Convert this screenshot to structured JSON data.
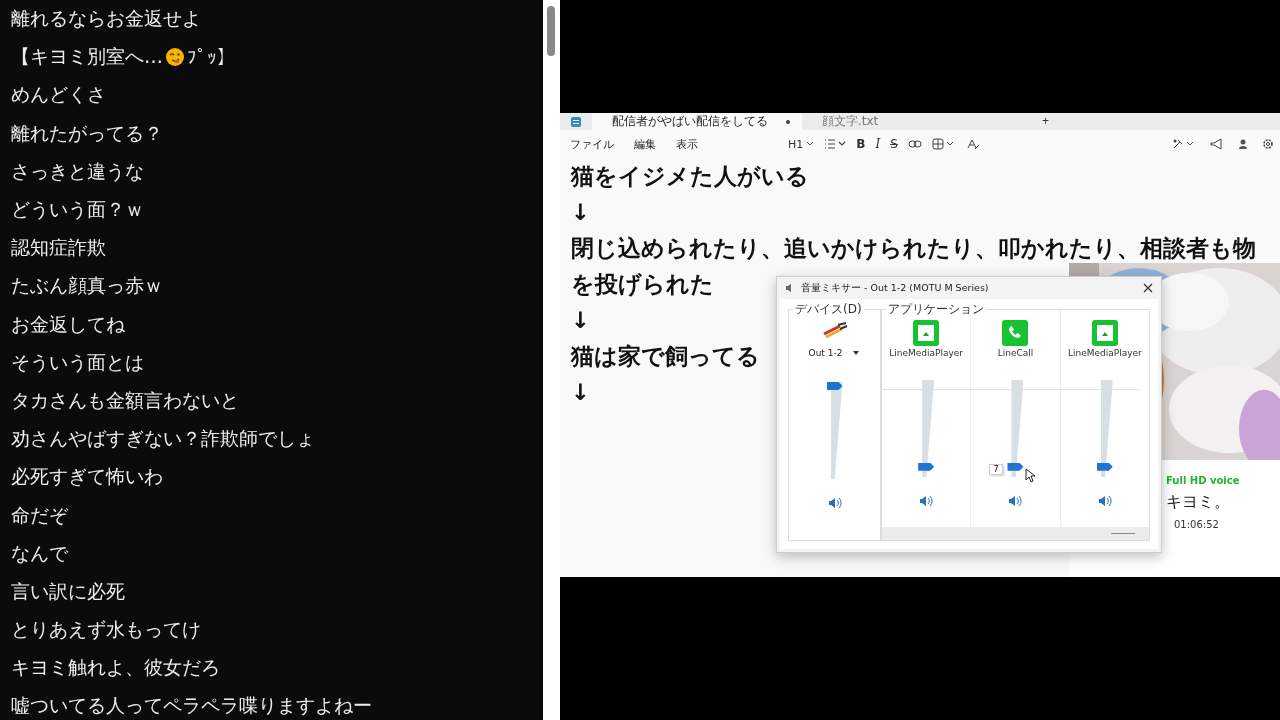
{
  "chat": {
    "messages": [
      {
        "kind": "text",
        "text": "離れるならお金返せよ"
      },
      {
        "kind": "emoji",
        "text": "【キヨミ別室へ…",
        "text_after": "ﾌﾟｯ】"
      },
      {
        "kind": "text",
        "text": "めんどくさ"
      },
      {
        "kind": "text",
        "text": "離れたがってる？"
      },
      {
        "kind": "text",
        "text": "さっきと違うな"
      },
      {
        "kind": "text",
        "text": "どういう面？ｗ"
      },
      {
        "kind": "text",
        "text": "認知症詐欺"
      },
      {
        "kind": "text",
        "text": "たぶん顔真っ赤ｗ"
      },
      {
        "kind": "text",
        "text": "お金返してね"
      },
      {
        "kind": "text",
        "text": "そういう面とは"
      },
      {
        "kind": "text",
        "text": "タカさんも金額言わないと"
      },
      {
        "kind": "text",
        "text": "劝さんやばすぎない？詐欺師でしょ"
      },
      {
        "kind": "text",
        "text": "必死すぎて怖いわ"
      },
      {
        "kind": "text",
        "text": "命だぞ"
      },
      {
        "kind": "text",
        "text": "なんで"
      },
      {
        "kind": "text",
        "text": "言い訳に必死"
      },
      {
        "kind": "text",
        "text": "とりあえず水もってけ"
      },
      {
        "kind": "text",
        "text": "キヨミ触れよ、彼女だろ"
      },
      {
        "kind": "text",
        "text": "嘘ついてる人ってペラペラ喋りますよねー"
      }
    ]
  },
  "stream": {
    "notepad": {
      "tabs": [
        {
          "label": "配信者がやばい配信をしてる",
          "selected": true,
          "unsaved": true
        },
        {
          "label": "顔文字.txt",
          "selected": false,
          "unsaved": false
        }
      ],
      "new_tab": "+",
      "menu": [
        "ファイル",
        "編集",
        "表示"
      ],
      "heading_level": "H1",
      "format_buttons": [
        "B",
        "I",
        "S"
      ],
      "lines": [
        "猫をイジメた人がいる",
        "↓",
        "閉じ込められたり、追いかけられたり、叩かれたり、相談者も物",
        "を投げられた",
        "↓",
        "猫は家で飼ってる",
        "↓"
      ]
    },
    "mixer": {
      "title": "音量ミキサー - Out 1-2 (MOTU M Series)",
      "device_label": "デバイス(D)",
      "apps_label": "アプリケーション",
      "device": {
        "name": "Out 1-2",
        "level": 1.0
      },
      "apps": [
        {
          "name": "LineMediaPlayer",
          "kind": "media",
          "level": 0.07
        },
        {
          "name": "LineCall",
          "kind": "call",
          "level": 0.07,
          "tooltip": "7"
        },
        {
          "name": "LineMediaPlayer",
          "kind": "media",
          "level": 0.07
        }
      ]
    },
    "call": {
      "quality": "Full HD voice",
      "name": "キヨミ。",
      "duration": "01:06:52"
    }
  }
}
